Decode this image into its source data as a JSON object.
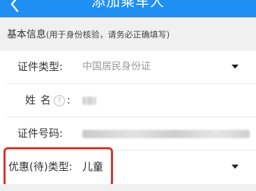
{
  "header": {
    "title": "添加乘车人",
    "back_icon": "chevron-left-icon",
    "color": "#1f8ff3"
  },
  "section": {
    "title": "基本信息",
    "hint": "(用于身份核验，请务必正确填写)"
  },
  "form": {
    "id_type": {
      "label": "证件类型:",
      "value": "中国居民身份证"
    },
    "name": {
      "label_first": "姓",
      "label_second": "名",
      "colon": ":",
      "help": "?"
    },
    "id_number": {
      "label": "证件号码:"
    },
    "discount_type": {
      "label": "优惠(待)类型:",
      "value": "儿童"
    }
  },
  "highlight_color": "#d8322d"
}
